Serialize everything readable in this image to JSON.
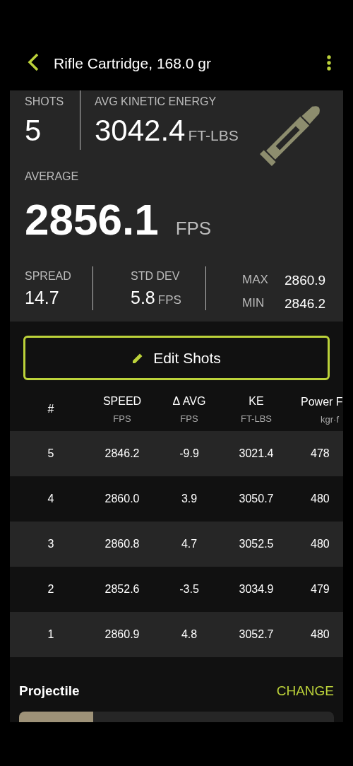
{
  "header": {
    "title": "Rifle Cartridge, 168.0 gr"
  },
  "summary": {
    "shots_label": "SHOTS",
    "shots": "5",
    "energy_label": "AVG KINETIC ENERGY",
    "energy": "3042.4",
    "energy_unit": "FT-LBS",
    "average_label": "AVERAGE",
    "average": "2856.1",
    "average_unit": "FPS",
    "spread_label": "SPREAD",
    "spread": "14.7",
    "stddev_label": "STD DEV",
    "stddev": "5.8",
    "stddev_unit": "FPS",
    "max_label": "MAX",
    "max": "2860.9",
    "min_label": "MIN",
    "min": "2846.2"
  },
  "edit_button": "Edit Shots",
  "table": {
    "columns": [
      {
        "label": "#"
      },
      {
        "label": "SPEED",
        "unit": "FPS"
      },
      {
        "label": "Δ AVG",
        "unit": "FPS"
      },
      {
        "label": "KE",
        "unit": "FT-LBS"
      },
      {
        "label": "Power F",
        "unit": "kgr·f"
      }
    ],
    "rows": [
      [
        "5",
        "2846.2",
        "-9.9",
        "3021.4",
        "478"
      ],
      [
        "4",
        "2860.0",
        "3.9",
        "3050.7",
        "480"
      ],
      [
        "3",
        "2860.8",
        "4.7",
        "3052.5",
        "480"
      ],
      [
        "2",
        "2852.6",
        "-3.5",
        "3034.9",
        "479"
      ],
      [
        "1",
        "2860.9",
        "4.8",
        "3052.7",
        "480"
      ]
    ]
  },
  "projectile": {
    "title": "Projectile",
    "action": "CHANGE"
  }
}
